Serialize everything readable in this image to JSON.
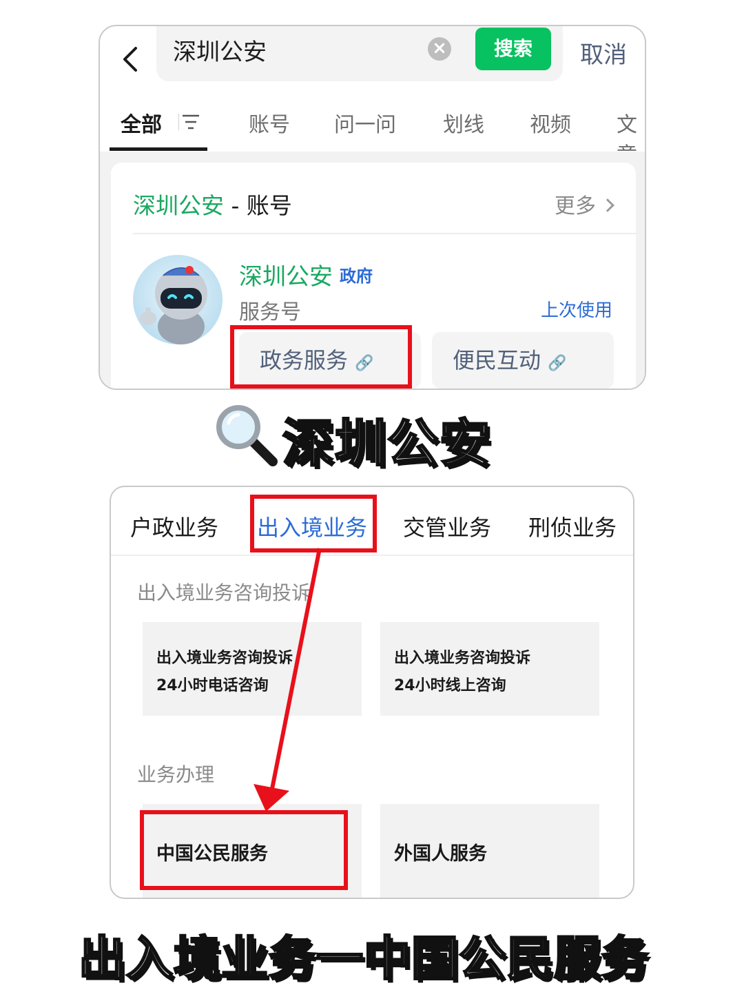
{
  "search": {
    "query": "深圳公安",
    "search_label": "搜索",
    "cancel_label": "取消"
  },
  "tabs": [
    "全部",
    "账号",
    "问一问",
    "划线",
    "视频",
    "文章"
  ],
  "result": {
    "section_keyword": "深圳公安",
    "section_suffix": " - 账号",
    "more_label": "更多",
    "account_name": "深圳公安",
    "account_tag": "政府",
    "account_type": "服务号",
    "last_used": "上次使用",
    "services": [
      "政务服务",
      "便民互动"
    ]
  },
  "caption_mid": "深圳公安",
  "menu": {
    "tabs": [
      "户政业务",
      "出入境业务",
      "交管业务",
      "刑侦业务"
    ],
    "active_tab": "出入境业务",
    "section1_label": "出入境业务咨询投诉",
    "tile1_line1": "出入境业务咨询投诉",
    "tile1_line2": "24小时电话咨询",
    "tile2_line1": "出入境业务咨询投诉",
    "tile2_line2": "24小时线上咨询",
    "section2_label": "业务办理",
    "tile3": "中国公民服务",
    "tile4": "外国人服务"
  },
  "caption_bottom": "出入境业务一中国公民服务",
  "colors": {
    "green": "#08c160",
    "keyword_green": "#1aa861",
    "link_blue": "#2b6bd6",
    "highlight_red": "#e8101a"
  },
  "icons": [
    "back-arrow-icon",
    "clear-icon",
    "filter-icon",
    "chevron-right-icon",
    "link-icon",
    "magnifier-icon",
    "robot-avatar-icon"
  ]
}
